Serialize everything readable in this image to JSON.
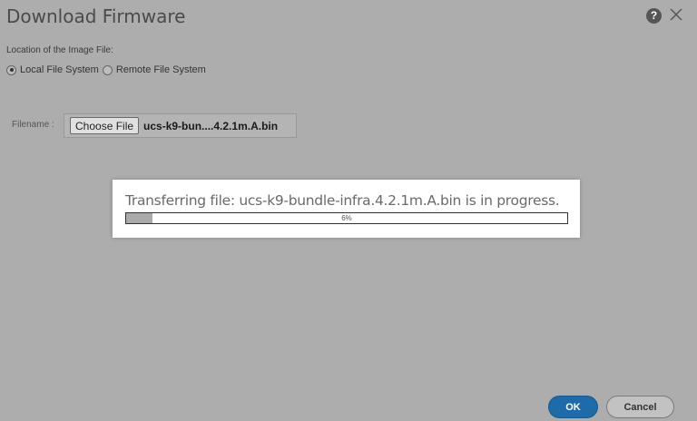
{
  "dialog": {
    "title": "Download Firmware",
    "help_label": "?",
    "location_label": "Location of the Image File:",
    "location_options": [
      {
        "label": "Local File System",
        "selected": true
      },
      {
        "label": "Remote File System",
        "selected": false
      }
    ],
    "filename_label": "Filename :",
    "choose_file_label": "Choose File",
    "selected_file": "ucs-k9-bun....4.2.1m.A.bin"
  },
  "progress": {
    "message": "Transferring file: ucs-k9-bundle-infra.4.2.1m.A.bin is in progress.",
    "percent_label": "6%",
    "percent": 6
  },
  "actions": {
    "ok_label": "OK",
    "cancel_label": "Cancel"
  },
  "colors": {
    "backdrop": "#adadae",
    "ok_button": "#1f6aa8",
    "progress_fill": "#aaaaaa"
  },
  "icons": {
    "help": "help-icon",
    "close": "close-icon"
  }
}
